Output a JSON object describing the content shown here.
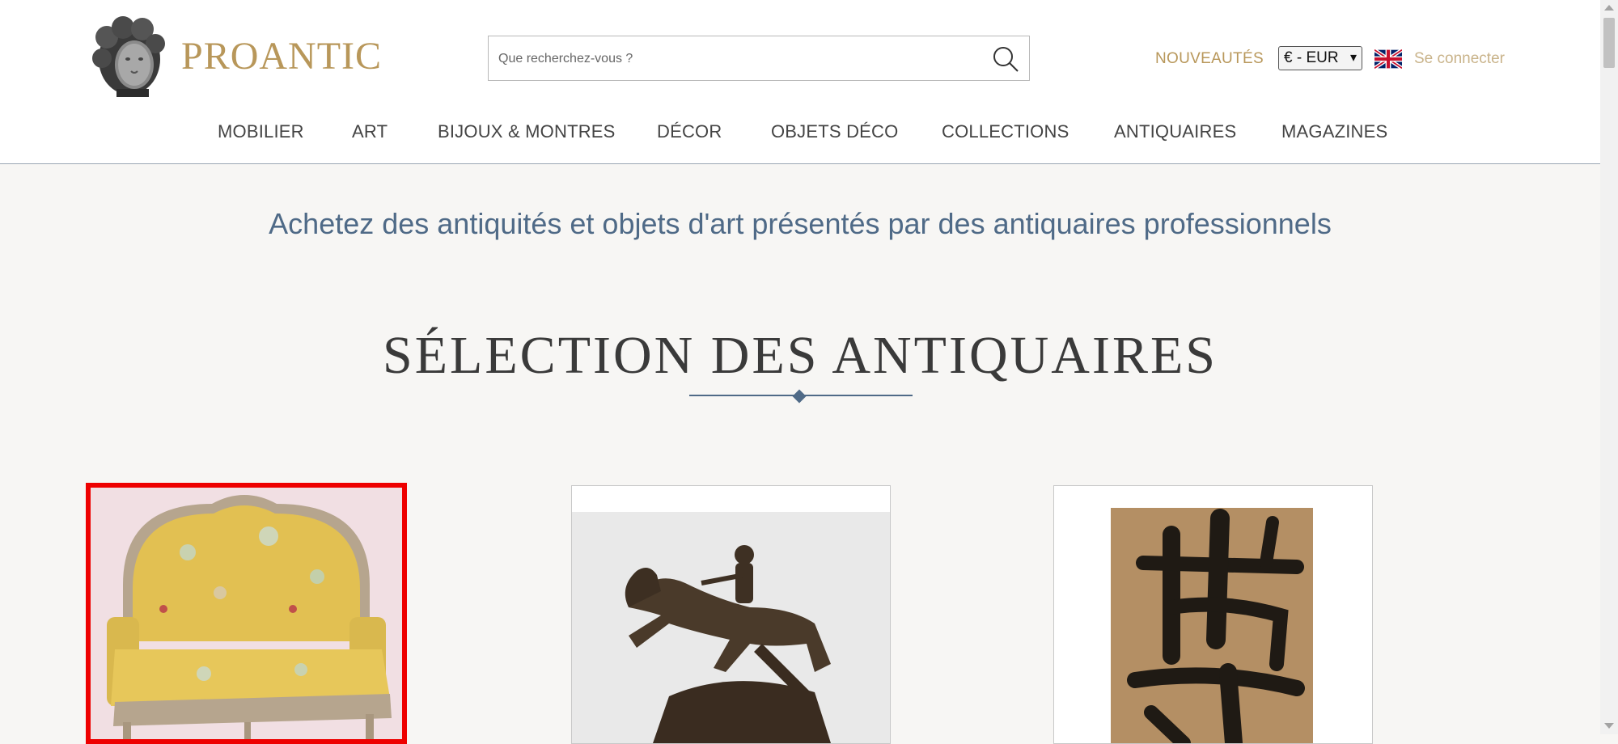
{
  "header": {
    "logo_text": "PROANTIC",
    "search_placeholder": "Que recherchez-vous ?",
    "nouveautes_label": "NOUVEAUTÉS",
    "currency_value": "€ - EUR",
    "language_flag": "uk-flag-icon",
    "login_label": "Se connecter"
  },
  "nav": {
    "items": [
      {
        "label": "MOBILIER"
      },
      {
        "label": "ART"
      },
      {
        "label": "BIJOUX & MONTRES"
      },
      {
        "label": "DÉCOR"
      },
      {
        "label": "OBJETS DÉCO"
      },
      {
        "label": "COLLECTIONS"
      },
      {
        "label": "ANTIQUAIRES"
      },
      {
        "label": "MAGAZINES"
      }
    ]
  },
  "main": {
    "tagline": "Achetez des antiquités et objets d'art présentés par des antiquaires professionnels",
    "section_title": "SÉLECTION DES ANTIQUAIRES",
    "products": [
      {
        "image": "louis-xv-settee",
        "selected": true
      },
      {
        "image": "bronze-horse-rider-sculpture",
        "selected": false
      },
      {
        "image": "calligraphy-painting",
        "selected": false
      }
    ]
  },
  "colors": {
    "brand_gold": "#b8975a",
    "accent_blue": "#4f6a87",
    "selection_red": "#ee0000"
  }
}
